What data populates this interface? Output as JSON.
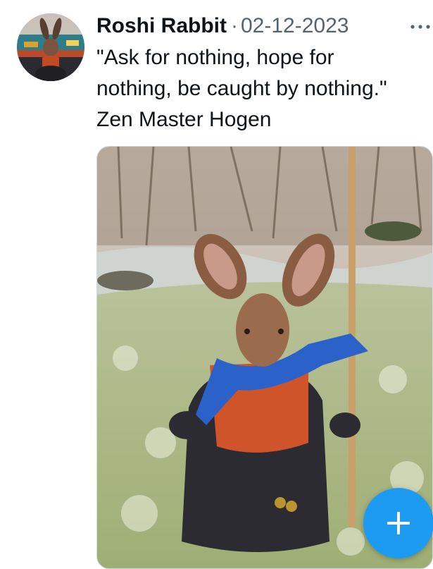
{
  "post": {
    "author_name": "Roshi Rabbit",
    "separator": "·",
    "date": "02-12-2023",
    "text_lines": [
      "\"Ask for nothing, hope for",
      "nothing, be caught by nothing.\"",
      "Zen Master Hogen"
    ]
  },
  "icons": {
    "more": "more-horizontal-icon",
    "compose": "plus-icon"
  },
  "colors": {
    "accent": "#1d9bf0",
    "secondary_text": "#536471",
    "primary_text": "#0f1419"
  }
}
